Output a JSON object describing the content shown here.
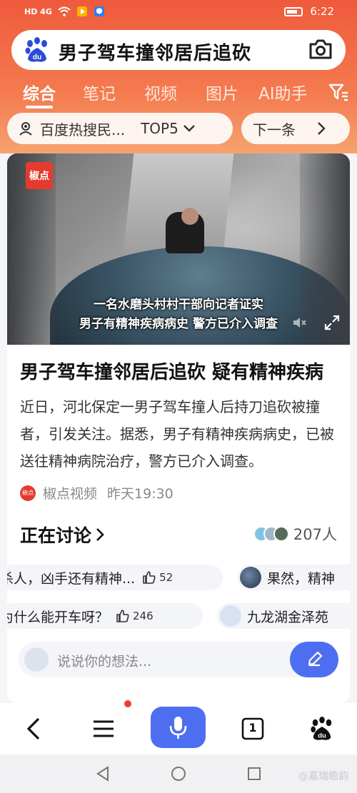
{
  "status_bar": {
    "network": "HD 4G",
    "time": "6:22"
  },
  "search": {
    "query": "男子驾车撞邻居后追砍"
  },
  "tabs": [
    {
      "label": "综合",
      "active": true
    },
    {
      "label": "笔记"
    },
    {
      "label": "视频"
    },
    {
      "label": "图片"
    },
    {
      "label": "AI助手"
    }
  ],
  "hot_pill": {
    "label": "百度热搜民...",
    "rank": "TOP5"
  },
  "next_pill": {
    "label": "下一条"
  },
  "video": {
    "badge": "椒点",
    "caption_line1": "一名水磨头村村干部向记者证实",
    "caption_line2": "男子有精神疾病病史 警方已介入调查"
  },
  "article": {
    "title": "男子驾车撞邻居后追砍 疑有精神疾病",
    "summary": "近日，河北保定一男子驾车撞人后持刀追砍被撞者，引发关注。据悉，男子有精神疾病病史，已被送往精神病院治疗，警方已介入调查。",
    "source_logo": "椒点",
    "source": "椒点视频",
    "time": "昨天19:30"
  },
  "discussion": {
    "title": "正在讨论",
    "participants": "207人",
    "comments": [
      {
        "text": "杀人，凶手还有精神...",
        "likes": "52"
      },
      {
        "text": "果然，精神"
      },
      {
        "text": "为什么能开车呀？",
        "likes": "246"
      },
      {
        "text": "九龙湖金泽苑"
      }
    ],
    "input_placeholder": "说说你的想法..."
  },
  "bottom_nav": {
    "tabs_count": "1"
  },
  "watermark": "@嘉瑞瞻韵",
  "colors": {
    "accent": "#4e6ef2",
    "header": "#ef5a3c",
    "badge_red": "#e53b2e"
  }
}
